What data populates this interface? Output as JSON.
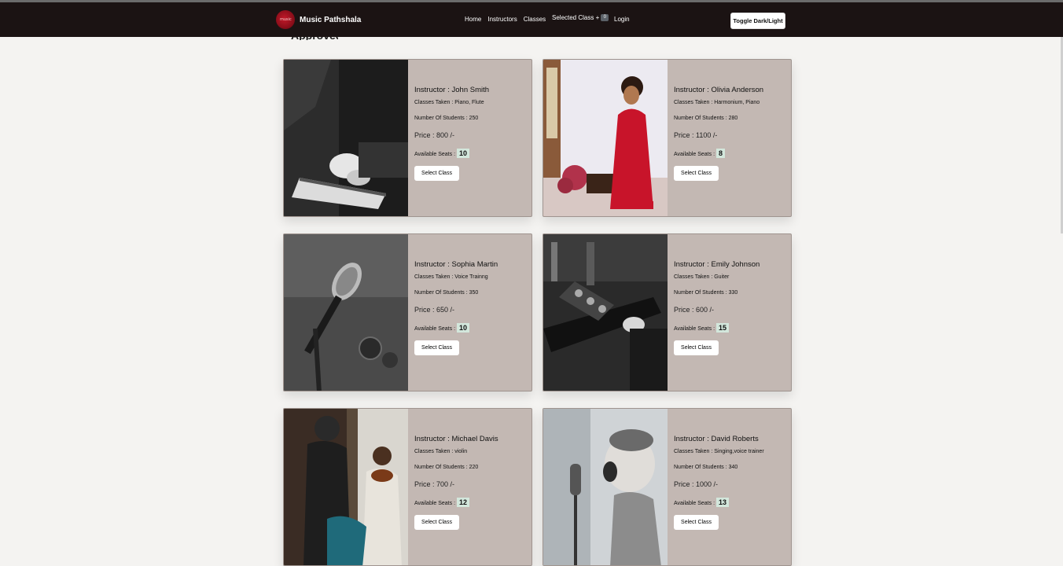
{
  "nav": {
    "brand": "Music Pathshala",
    "logo_text": "music",
    "links": [
      "Home",
      "Instructors",
      "Classes"
    ],
    "selected_label": "Selected Class +",
    "selected_count": "0",
    "login": "Login",
    "toggle": "Toggle Dark/Light"
  },
  "cards": [
    {
      "instructor": "Instructor : John Smith",
      "classes": "Classes Taken : Piano, Flute",
      "students": "Number Of Students : 250",
      "price": "Price : 800 /-",
      "seats_label": "Available Seats :",
      "seats": "10",
      "button": "Select Class",
      "photo": "piano-photo"
    },
    {
      "instructor": "Instructor : Olivia Anderson",
      "classes": "Classes Taken : Harmonium, Piano",
      "students": "Number Of Students : 280",
      "price": "Price : 1100 /-",
      "seats_label": "Available Seats :",
      "seats": "8",
      "button": "Select Class",
      "photo": "harmonium-girl-photo"
    },
    {
      "instructor": "Instructor : Sophia Martin",
      "classes": "Classes Taken : Voice Trainng",
      "students": "Number Of Students : 350",
      "price": "Price : 650 /-",
      "seats_label": "Available Seats :",
      "seats": "10",
      "button": "Select Class",
      "photo": "microphone-photo"
    },
    {
      "instructor": "Instructor : Emily Johnson",
      "classes": "Classes Taken : Guiter",
      "students": "Number Of Students : 330",
      "price": "Price : 600 /-",
      "seats_label": "Available Seats :",
      "seats": "15",
      "button": "Select Class",
      "photo": "guitar-photo"
    },
    {
      "instructor": "Instructor : Michael Davis",
      "classes": "Classes Taken : violin",
      "students": "Number Of Students : 220",
      "price": "Price : 700 /-",
      "seats_label": "Available Seats :",
      "seats": "12",
      "button": "Select Class",
      "photo": "violin-photo"
    },
    {
      "instructor": "Instructor : David Roberts",
      "classes": "Classes Taken : Singing,voice trainer",
      "students": "Number Of Students : 340",
      "price": "Price : 1000 /-",
      "seats_label": "Available Seats :",
      "seats": "13",
      "button": "Select Class",
      "photo": "singing-boy-photo"
    }
  ]
}
